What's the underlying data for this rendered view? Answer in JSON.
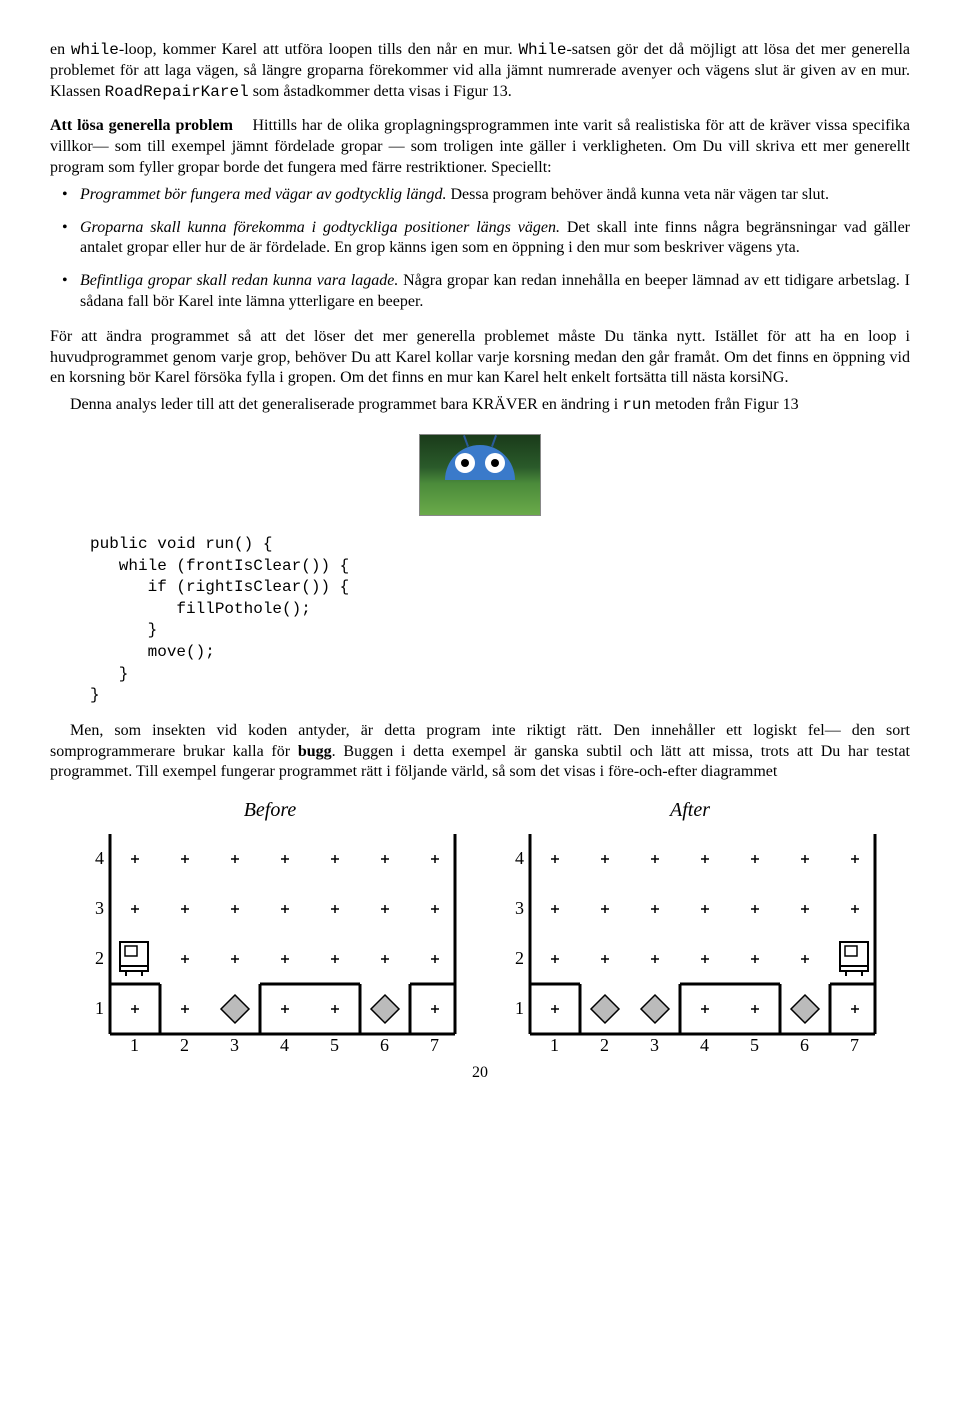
{
  "p1": {
    "pre": "en ",
    "kw1": "while",
    "mid1": "-loop, kommer Karel att utföra loopen tills den når en mur. ",
    "kw2": "While",
    "mid2": "-satsen gör det då möjligt att lösa det mer generella problemet för att laga vägen, så längre groparna förekommer vid alla jämnt numrerade avenyer och vägens slut är given av en mur. Klassen ",
    "kw3": "RoadRepairKarel",
    "post": " som åstadkommer detta visas i Figur 13."
  },
  "section": {
    "head": "Att lösa generella problem",
    "body": "Hittills har de olika groplagningsprogrammen inte varit så realistiska för att de kräver vissa specifika villkor— som till exempel jämnt fördelade gropar — som troligen inte gäller i verkligheten. Om Du vill skriva ett mer generellt program som fyller gropar borde det fungera med färre restriktioner. Speciellt:"
  },
  "bullets": [
    {
      "lead": "Programmet bör fungera med vägar av godtycklig längd.",
      "rest": " Dessa program behöver ändå kunna veta när vägen tar slut."
    },
    {
      "lead": "Groparna skall kunna förekomma i godtyckliga positioner längs vägen.",
      "rest": " Det skall inte finns några begränsningar vad gäller antalet gropar eller hur de är fördelade. En grop känns igen som en öppning i den mur som beskriver vägens yta."
    },
    {
      "lead": "Befintliga gropar skall redan kunna vara lagade.",
      "rest": " Några gropar kan redan innehålla en beeper lämnad av ett tidigare arbetslag. I sådana fall bör Karel inte lämna ytterligare en beeper."
    }
  ],
  "p2": "För att ändra programmet så att det löser det mer generella problemet måste Du tänka nytt. Istället för att ha en loop i huvudprogrammet genom varje grop, behöver Du att Karel kollar varje korsning medan den går framåt. Om det finns en öppning vid en korsning bör Karel försöka fylla i gropen. Om det finns en mur kan Karel helt enkelt fortsätta till nästa korsiNG.",
  "p3": {
    "pre": "Denna analys leder till att det generaliserade programmet bara KRÄVER en ändring i ",
    "kw": "run",
    "post": " metoden från Figur 13"
  },
  "code": "public void run() {\n   while (frontIsClear()) {\n      if (rightIsClear()) {\n         fillPothole();\n      }\n      move();\n   }\n}",
  "p4": {
    "pre": "Men, som insekten vid koden antyder, är detta program inte riktigt rätt. Den innehåller ett logiskt fel— den sort somprogrammerare brukar kalla för ",
    "kw": "bugg",
    "post": ". Buggen i detta exempel är ganska subtil och lätt att missa, trots att Du har testat programmet. Till exempel fungerar programmet rätt i följande värld, så som det visas i före-och-efter diagrammet"
  },
  "diagrams": {
    "before": "Before",
    "after": "After"
  },
  "page": "20"
}
